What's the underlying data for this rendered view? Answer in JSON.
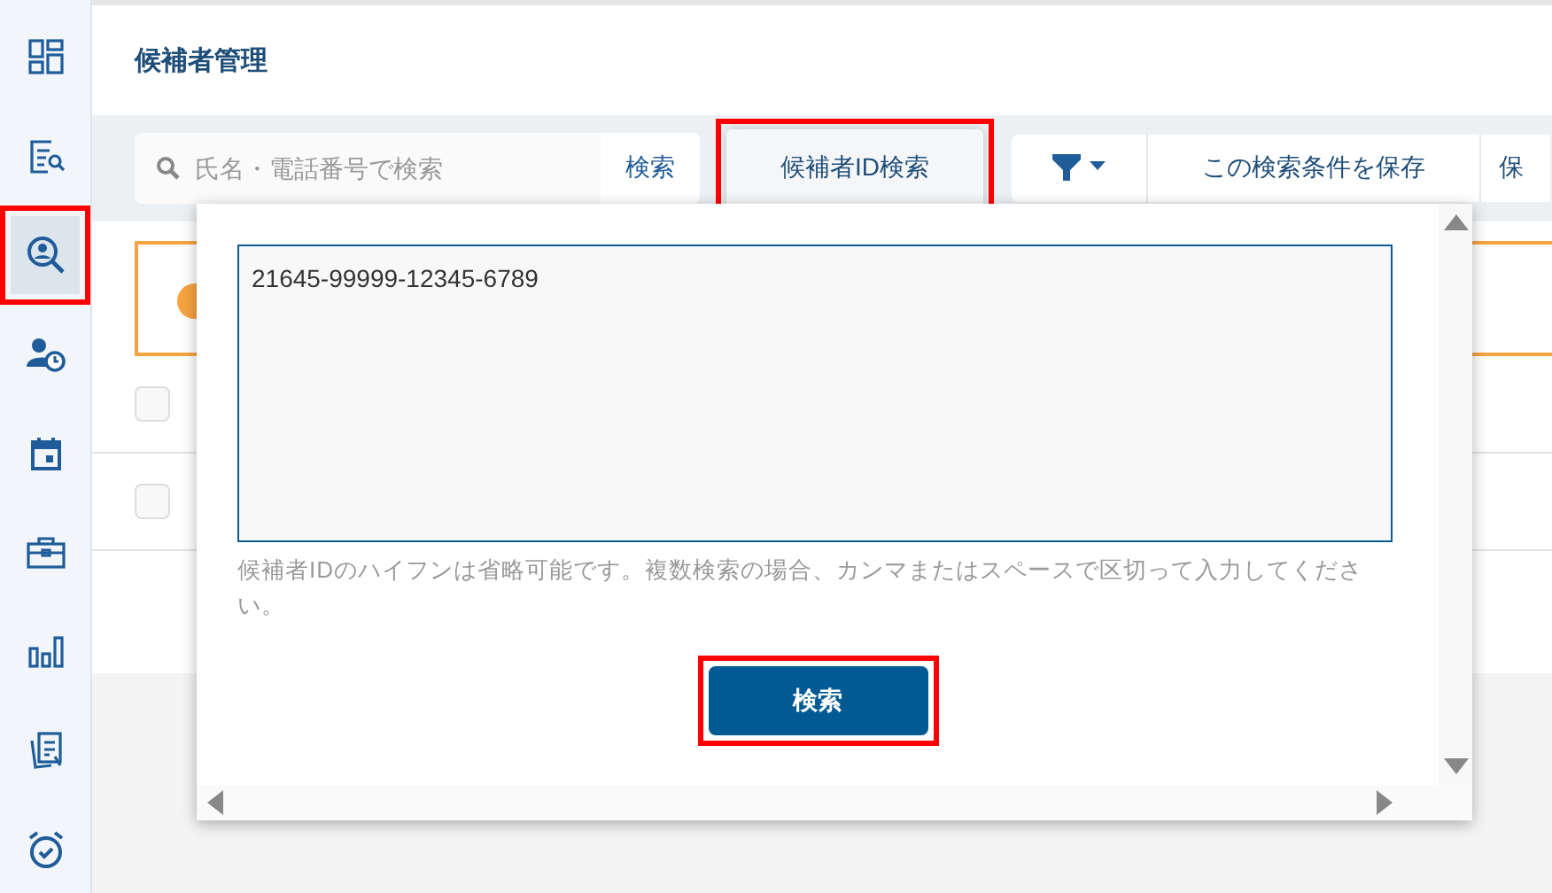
{
  "sidebar": {
    "items": [
      {
        "kind": "dashboard",
        "selected": false,
        "highlighted": false
      },
      {
        "kind": "document-search",
        "selected": false,
        "highlighted": false
      },
      {
        "kind": "person-search",
        "selected": true,
        "highlighted": true
      },
      {
        "kind": "person-clock",
        "selected": false,
        "highlighted": false
      },
      {
        "kind": "calendar",
        "selected": false,
        "highlighted": false
      },
      {
        "kind": "briefcase",
        "selected": false,
        "highlighted": false
      },
      {
        "kind": "bar-chart",
        "selected": false,
        "highlighted": false
      },
      {
        "kind": "documents",
        "selected": false,
        "highlighted": false
      },
      {
        "kind": "alarm",
        "selected": false,
        "highlighted": false
      }
    ]
  },
  "header": {
    "title": "候補者管理"
  },
  "toolbar": {
    "search": {
      "placeholder": "氏名・電話番号で検索"
    },
    "search_button": "検索",
    "id_search_button": {
      "label": "候補者ID検索",
      "highlighted": true
    },
    "save_condition_button": "この検索条件を保存",
    "cut_button": "保"
  },
  "rows": [
    {
      "checked": false
    },
    {
      "checked": false
    }
  ],
  "popup": {
    "textarea": {
      "value": "21645-99999-12345-6789"
    },
    "help": "候補者IDのハイフンは省略可能です。複数検索の場合、カンマまたはスペースで区切って入力してください。",
    "search_button": {
      "label": "検索",
      "highlighted": true
    }
  }
}
